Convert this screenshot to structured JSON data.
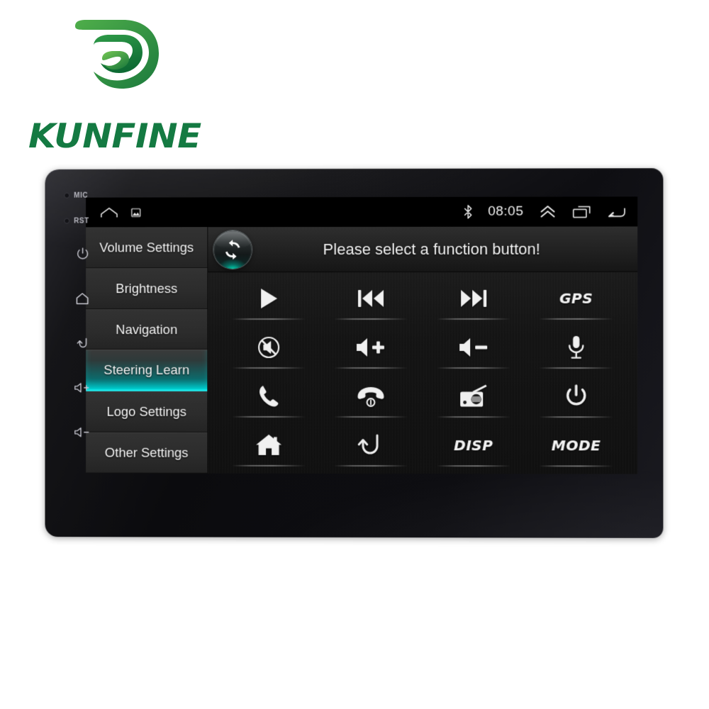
{
  "brand": {
    "name": "KUNFINE",
    "logo_icon": "swirl-leaf-mark",
    "color": "#147a42"
  },
  "device": {
    "bezel_indicators": [
      {
        "label": "MIC",
        "icon": "mic-indicator-dot"
      },
      {
        "label": "RST",
        "icon": "reset-indicator-dot"
      }
    ],
    "bezel_buttons": [
      {
        "name": "power",
        "icon": "power-icon"
      },
      {
        "name": "home",
        "icon": "home-icon"
      },
      {
        "name": "back",
        "icon": "back-arrow-icon"
      },
      {
        "name": "volume-up",
        "icon": "volume-up-icon"
      },
      {
        "name": "volume-down",
        "icon": "volume-down-icon"
      }
    ]
  },
  "statusbar": {
    "left_icons": [
      {
        "name": "home-icon"
      },
      {
        "name": "screenshot-icon"
      }
    ],
    "bluetooth_icon": "bluetooth-icon",
    "clock": "08:05",
    "expand_icon": "double-chevron-up-icon",
    "recents_icon": "recents-icon",
    "back_icon": "back-arrow-icon"
  },
  "sidebar": {
    "items": [
      {
        "label": "Volume Settings",
        "selected": false
      },
      {
        "label": "Brightness",
        "selected": false
      },
      {
        "label": "Navigation",
        "selected": false
      },
      {
        "label": "Steering Learn",
        "selected": true
      },
      {
        "label": "Logo Settings",
        "selected": false
      },
      {
        "label": "Other Settings",
        "selected": false
      }
    ],
    "selected_highlight_color": "#00b9bb"
  },
  "panel": {
    "refresh_icon": "refresh-sync-icon",
    "title": "Please select a function button!",
    "buttons": [
      {
        "icon": "play-icon",
        "label": "",
        "type": "icon"
      },
      {
        "icon": "previous-icon",
        "label": "",
        "type": "icon"
      },
      {
        "icon": "next-icon",
        "label": "",
        "type": "icon"
      },
      {
        "icon": "gps-label",
        "label": "GPS",
        "type": "text"
      },
      {
        "icon": "mute-icon",
        "label": "",
        "type": "icon"
      },
      {
        "icon": "volume-up-icon",
        "label": "",
        "type": "icon"
      },
      {
        "icon": "volume-down-icon",
        "label": "",
        "type": "icon"
      },
      {
        "icon": "microphone-icon",
        "label": "",
        "type": "icon"
      },
      {
        "icon": "call-answer-icon",
        "label": "",
        "type": "icon"
      },
      {
        "icon": "call-end-icon",
        "label": "",
        "type": "icon"
      },
      {
        "icon": "radio-icon",
        "label": "",
        "type": "icon"
      },
      {
        "icon": "power-icon",
        "label": "",
        "type": "icon"
      },
      {
        "icon": "home-icon",
        "label": "",
        "type": "icon"
      },
      {
        "icon": "back-icon",
        "label": "",
        "type": "icon"
      },
      {
        "icon": "disp-label",
        "label": "DISP",
        "type": "text"
      },
      {
        "icon": "mode-label",
        "label": "MODE",
        "type": "text"
      }
    ]
  }
}
